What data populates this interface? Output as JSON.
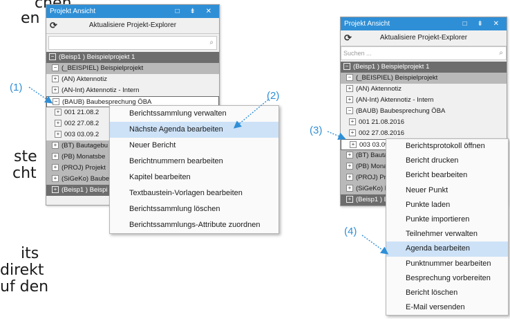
{
  "background_text": [
    "chen",
    "en",
    "ste",
    "cht",
    "its",
    "direkt",
    "uf den"
  ],
  "left_panel": {
    "title": "Projekt Ansicht",
    "title_buttons": "□ ⇟ ✕",
    "refresh_label": "Aktualisiere Projekt-Explorer",
    "search_placeholder": "",
    "tree": [
      {
        "exp": "−",
        "text": "(Beisp1 ) Beispielprojekt 1"
      },
      {
        "exp": "−",
        "text": "(_BEISPIEL) Beispielprojekt"
      },
      {
        "exp": "+",
        "text": "(AN) Aktennotiz"
      },
      {
        "exp": "+",
        "text": "(AN-Int) Aktennotiz - Intern"
      },
      {
        "exp": "−",
        "text": "(BAUB) Baubesprechung ÖBA"
      },
      {
        "exp": "+",
        "text": "001   21.08.2"
      },
      {
        "exp": "+",
        "text": "002   27.08.2"
      },
      {
        "exp": "+",
        "text": "003   03.09.2"
      },
      {
        "exp": "+",
        "text": "(BT) Bautagebu"
      },
      {
        "exp": "+",
        "text": "(PB) Monatsbe"
      },
      {
        "exp": "+",
        "text": "(PROJ) Projekt"
      },
      {
        "exp": "+",
        "text": "(SiGeKo) Baube"
      },
      {
        "exp": "+",
        "text": "(Beisp1 ) Beispi"
      }
    ]
  },
  "left_menu": {
    "items": [
      "Berichtssammlung verwalten",
      "Nächste Agenda bearbeiten",
      "Neuer Bericht",
      "Berichtnummern bearbeiten",
      "Kapitel bearbeiten",
      "Textbaustein-Vorlagen bearbeiten",
      "Berichtssammlung löschen",
      "Berichtssammlungs-Attribute zuordnen"
    ]
  },
  "right_panel": {
    "title": "Projekt Ansicht",
    "title_buttons": "□ ⇟ ✕",
    "refresh_label": "Aktualisiere Projekt-Explorer",
    "search_placeholder": "Suchen ...",
    "tree": [
      {
        "exp": "−",
        "text": "(Beisp1 ) Beispielprojekt 1"
      },
      {
        "exp": "−",
        "text": "(_BEISPIEL) Beispielprojekt"
      },
      {
        "exp": "+",
        "text": "(AN) Aktennotiz"
      },
      {
        "exp": "+",
        "text": "(AN-Int) Aktennotiz - Intern"
      },
      {
        "exp": "−",
        "text": "(BAUB) Baubesprechung ÖBA"
      },
      {
        "exp": "+",
        "text": "001   21.08.2016"
      },
      {
        "exp": "+",
        "text": "002   27.08.2016"
      },
      {
        "exp": "+",
        "text": "003   03.09.2016"
      },
      {
        "exp": "+",
        "text": "(BT) Bauta"
      },
      {
        "exp": "+",
        "text": "(PB) Mona"
      },
      {
        "exp": "+",
        "text": "(PROJ) Pr"
      },
      {
        "exp": "+",
        "text": "(SiGeKo) E"
      },
      {
        "exp": "+",
        "text": "(Beisp1 ) B"
      }
    ]
  },
  "right_menu": {
    "items": [
      "Berichtsprotokoll öffnen",
      "Bericht drucken",
      "Bericht bearbeiten",
      "Neuer Punkt",
      "Punkte laden",
      "Punkte importieren",
      "Teilnehmer verwalten",
      "Agenda bearbeiten",
      "Punktnummer bearbeiten",
      "Besprechung vorbereiten",
      "Bericht löschen",
      "E-Mail versenden"
    ]
  },
  "callouts": [
    "(1)",
    "(2)",
    "(3)",
    "(4)"
  ],
  "colors": {
    "accent": "#2f8fd6",
    "highlight": "#cde2f7",
    "root_row": "#6d6d6d",
    "sub_row": "#b9b9b9"
  }
}
